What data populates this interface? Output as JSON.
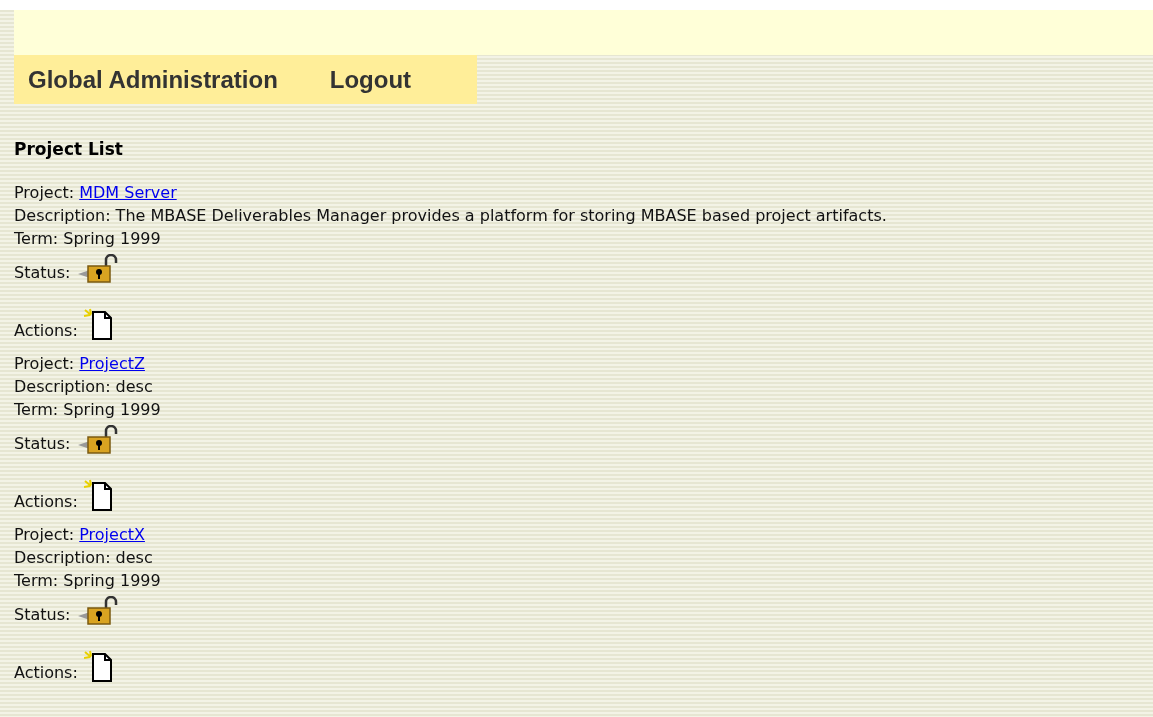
{
  "nav": [
    {
      "label": "Global Administration"
    },
    {
      "label": "Logout"
    }
  ],
  "heading": "Project List",
  "projects": [
    {
      "project_label": "Project:",
      "name": "MDM Server",
      "description": "Description: The MBASE Deliverables Manager provides a platform for storing MBASE based project artifacts.",
      "term": "Term: Spring 1999",
      "status_label": "Status:",
      "actions_label": "Actions:"
    },
    {
      "project_label": "Project:",
      "name": "ProjectZ",
      "description": "Description: desc",
      "term": "Term: Spring 1999",
      "status_label": "Status:",
      "actions_label": "Actions:"
    },
    {
      "project_label": "Project:",
      "name": "ProjectX",
      "description": "Description: desc",
      "term": "Term: Spring 1999",
      "status_label": "Status:",
      "actions_label": "Actions:"
    }
  ]
}
